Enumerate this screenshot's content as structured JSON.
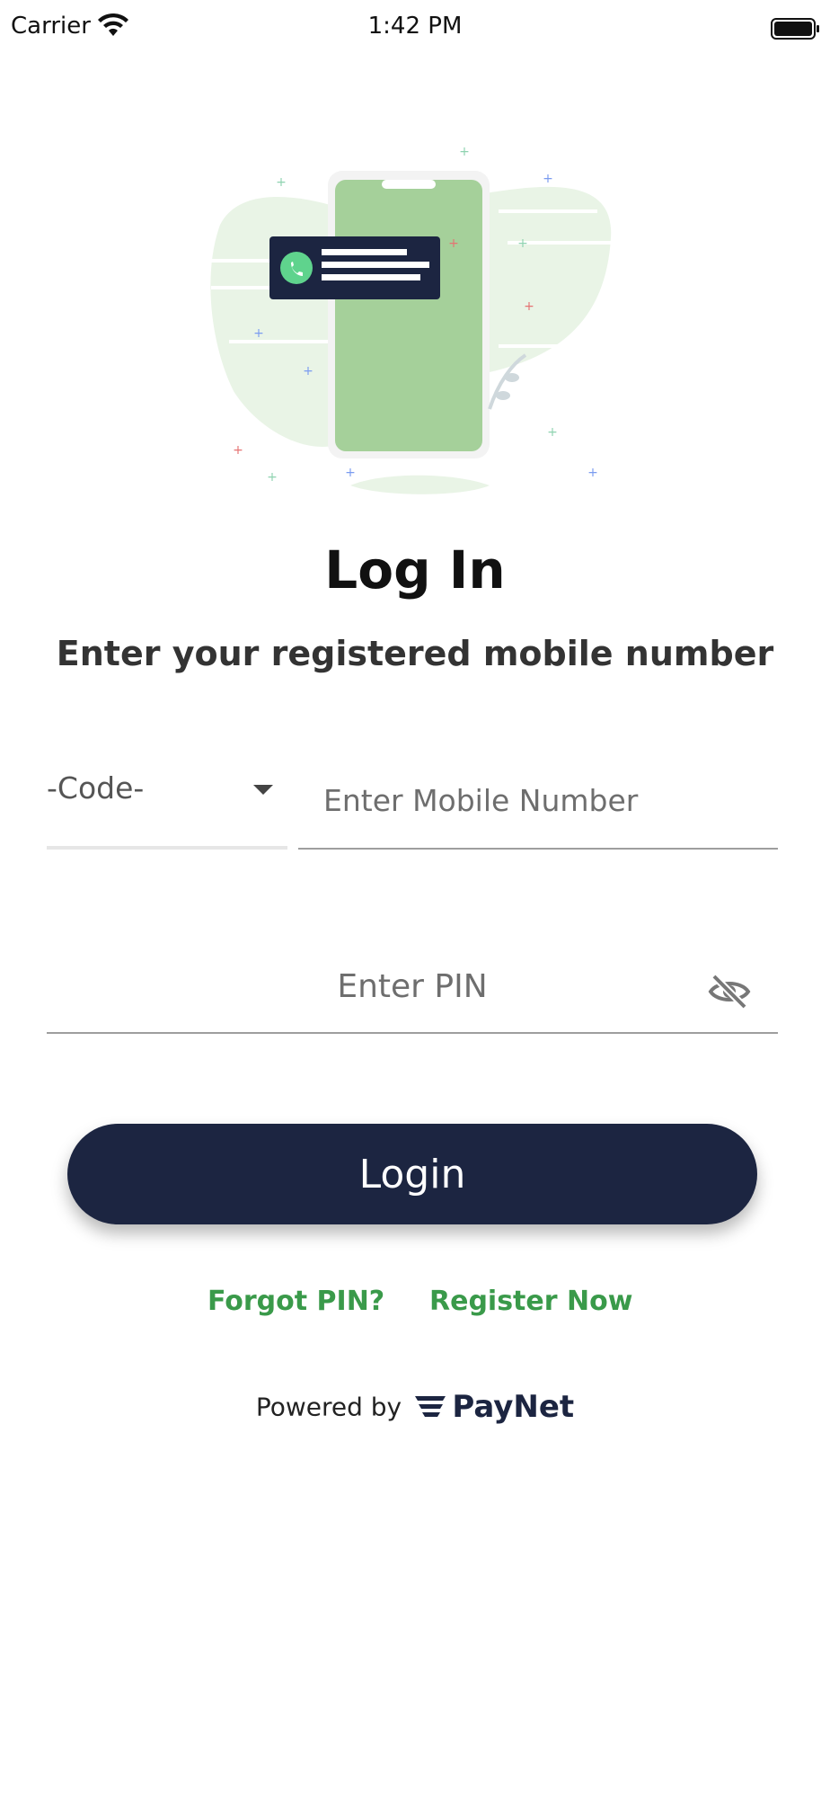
{
  "status_bar": {
    "carrier": "Carrier",
    "time": "1:42 PM",
    "wifi_icon": "wifi-icon",
    "battery_icon": "battery-icon"
  },
  "illustration": {
    "icon": "phone-call-illustration"
  },
  "login": {
    "title": "Log In",
    "subtitle": "Enter your registered mobile number",
    "code_label": "-Code-",
    "mobile_placeholder": "Enter Mobile Number",
    "pin_placeholder": "Enter PIN",
    "button_label": "Login",
    "forgot_link": "Forgot PIN?",
    "register_link": "Register Now"
  },
  "footer": {
    "powered_by": "Powered by",
    "brand": "PayNet"
  },
  "colors": {
    "primary": "#1c2541",
    "link": "#3a9a4a",
    "illustration_green": "#a5d09a"
  }
}
